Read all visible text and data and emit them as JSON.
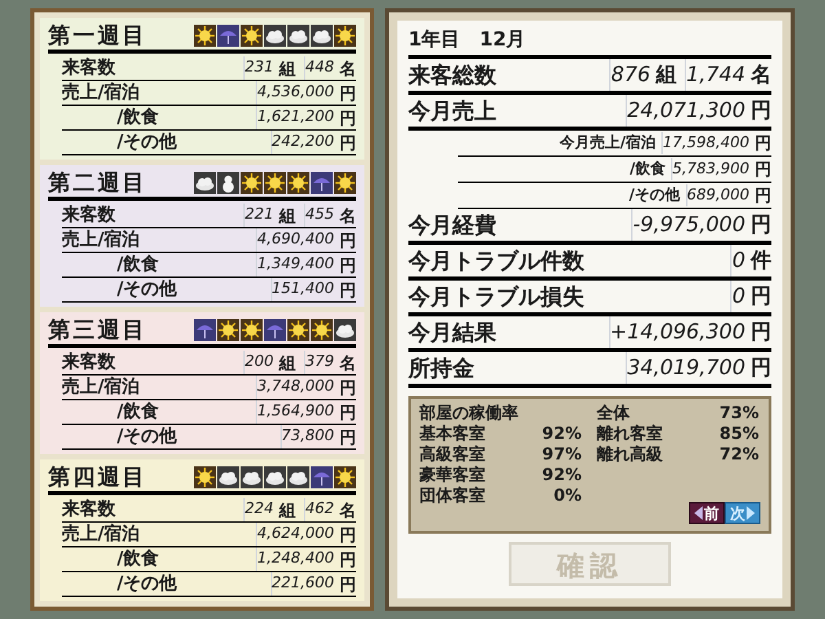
{
  "weeks": [
    {
      "title": "第一週目",
      "color": "#eef2dc",
      "weather": [
        {
          "kind": "sun"
        },
        {
          "kind": "rain"
        },
        {
          "kind": "sun"
        },
        {
          "kind": "cloud"
        },
        {
          "kind": "cloud"
        },
        {
          "kind": "cloud"
        },
        {
          "kind": "sun"
        }
      ],
      "rows": [
        {
          "label": "来客数",
          "kind": "main",
          "values": [
            {
              "value": "231",
              "unit": "組"
            },
            {
              "value": "448",
              "unit": "名"
            }
          ]
        },
        {
          "label": "売上/宿泊",
          "kind": "main",
          "values": [
            {
              "value": "4,536,000",
              "unit": "円"
            }
          ]
        },
        {
          "label": "/飲食",
          "kind": "sub",
          "values": [
            {
              "value": "1,621,200",
              "unit": "円"
            }
          ]
        },
        {
          "label": "/その他",
          "kind": "sub",
          "values": [
            {
              "value": "242,200",
              "unit": "円"
            }
          ]
        }
      ]
    },
    {
      "title": "第二週目",
      "color": "#ebe5ef",
      "weather": [
        {
          "kind": "cloud"
        },
        {
          "kind": "snow"
        },
        {
          "kind": "sun"
        },
        {
          "kind": "sun"
        },
        {
          "kind": "sun"
        },
        {
          "kind": "rain"
        },
        {
          "kind": "sun"
        }
      ],
      "rows": [
        {
          "label": "来客数",
          "kind": "main",
          "values": [
            {
              "value": "221",
              "unit": "組"
            },
            {
              "value": "455",
              "unit": "名"
            }
          ]
        },
        {
          "label": "売上/宿泊",
          "kind": "main",
          "values": [
            {
              "value": "4,690,400",
              "unit": "円"
            }
          ]
        },
        {
          "label": "/飲食",
          "kind": "sub",
          "values": [
            {
              "value": "1,349,400",
              "unit": "円"
            }
          ]
        },
        {
          "label": "/その他",
          "kind": "sub",
          "values": [
            {
              "value": "151,400",
              "unit": "円"
            }
          ]
        }
      ]
    },
    {
      "title": "第三週目",
      "color": "#f5e5e4",
      "weather": [
        {
          "kind": "rain"
        },
        {
          "kind": "sun"
        },
        {
          "kind": "sun"
        },
        {
          "kind": "rain"
        },
        {
          "kind": "sun"
        },
        {
          "kind": "sun"
        },
        {
          "kind": "cloud"
        }
      ],
      "rows": [
        {
          "label": "来客数",
          "kind": "main",
          "values": [
            {
              "value": "200",
              "unit": "組"
            },
            {
              "value": "379",
              "unit": "名"
            }
          ]
        },
        {
          "label": "売上/宿泊",
          "kind": "main",
          "values": [
            {
              "value": "3,748,000",
              "unit": "円"
            }
          ]
        },
        {
          "label": "/飲食",
          "kind": "sub",
          "values": [
            {
              "value": "1,564,900",
              "unit": "円"
            }
          ]
        },
        {
          "label": "/その他",
          "kind": "sub",
          "values": [
            {
              "value": "73,800",
              "unit": "円"
            }
          ]
        }
      ]
    },
    {
      "title": "第四週目",
      "color": "#f5f1d4",
      "weather": [
        {
          "kind": "sun"
        },
        {
          "kind": "cloud"
        },
        {
          "kind": "cloud"
        },
        {
          "kind": "cloud"
        },
        {
          "kind": "cloud"
        },
        {
          "kind": "rain"
        },
        {
          "kind": "sun"
        }
      ],
      "rows": [
        {
          "label": "来客数",
          "kind": "main",
          "values": [
            {
              "value": "224",
              "unit": "組"
            },
            {
              "value": "462",
              "unit": "名"
            }
          ]
        },
        {
          "label": "売上/宿泊",
          "kind": "main",
          "values": [
            {
              "value": "4,624,000",
              "unit": "円"
            }
          ]
        },
        {
          "label": "/飲食",
          "kind": "sub",
          "values": [
            {
              "value": "1,248,400",
              "unit": "円"
            }
          ]
        },
        {
          "label": "/その他",
          "kind": "sub",
          "values": [
            {
              "value": "221,600",
              "unit": "円"
            }
          ]
        }
      ]
    }
  ],
  "month": {
    "year": "1年目",
    "month": "12月"
  },
  "summary": [
    {
      "label": "来客総数",
      "kind": "main",
      "values": [
        {
          "value": "876",
          "unit": "組"
        },
        {
          "value": "1,744",
          "unit": "名"
        }
      ]
    },
    {
      "label": "今月売上",
      "kind": "main",
      "values": [
        {
          "value": "24,071,300",
          "unit": "円"
        }
      ]
    },
    {
      "label": "今月売上/宿泊",
      "kind": "sub",
      "values": [
        {
          "value": "17,598,400",
          "unit": "円"
        }
      ]
    },
    {
      "label": "/飲食",
      "kind": "sub",
      "values": [
        {
          "value": "5,783,900",
          "unit": "円"
        }
      ]
    },
    {
      "label": "/その他",
      "kind": "sub",
      "values": [
        {
          "value": "689,000",
          "unit": "円"
        }
      ]
    },
    {
      "label": "今月経費",
      "kind": "main",
      "values": [
        {
          "value": "-9,975,000",
          "unit": "円"
        }
      ]
    },
    {
      "label": "今月トラブル件数",
      "kind": "main",
      "values": [
        {
          "value": "0",
          "unit": "件"
        }
      ]
    },
    {
      "label": "今月トラブル損失",
      "kind": "main",
      "values": [
        {
          "value": "0",
          "unit": "円"
        }
      ]
    },
    {
      "label": "今月結果",
      "kind": "main",
      "values": [
        {
          "value": "+14,096,300",
          "unit": "円"
        }
      ]
    },
    {
      "label": "所持金",
      "kind": "main",
      "values": [
        {
          "value": "34,019,700",
          "unit": "円"
        }
      ]
    }
  ],
  "occupancy": {
    "title": "部屋の稼働率",
    "left": [
      {
        "label": "基本客室",
        "value": "92%"
      },
      {
        "label": "高級客室",
        "value": "97%"
      },
      {
        "label": "豪華客室",
        "value": "92%"
      },
      {
        "label": "団体客室",
        "value": "0%"
      }
    ],
    "right": [
      {
        "label": "全体",
        "value": "73%"
      },
      {
        "label": "離れ客室",
        "value": "85%"
      },
      {
        "label": "離れ高級",
        "value": "72%"
      }
    ]
  },
  "nav": [
    {
      "label": "前",
      "kind": "prev",
      "selected": false
    },
    {
      "label": "次",
      "kind": "next",
      "selected": true
    }
  ],
  "confirm": {
    "label": "確認",
    "disabled": true
  }
}
